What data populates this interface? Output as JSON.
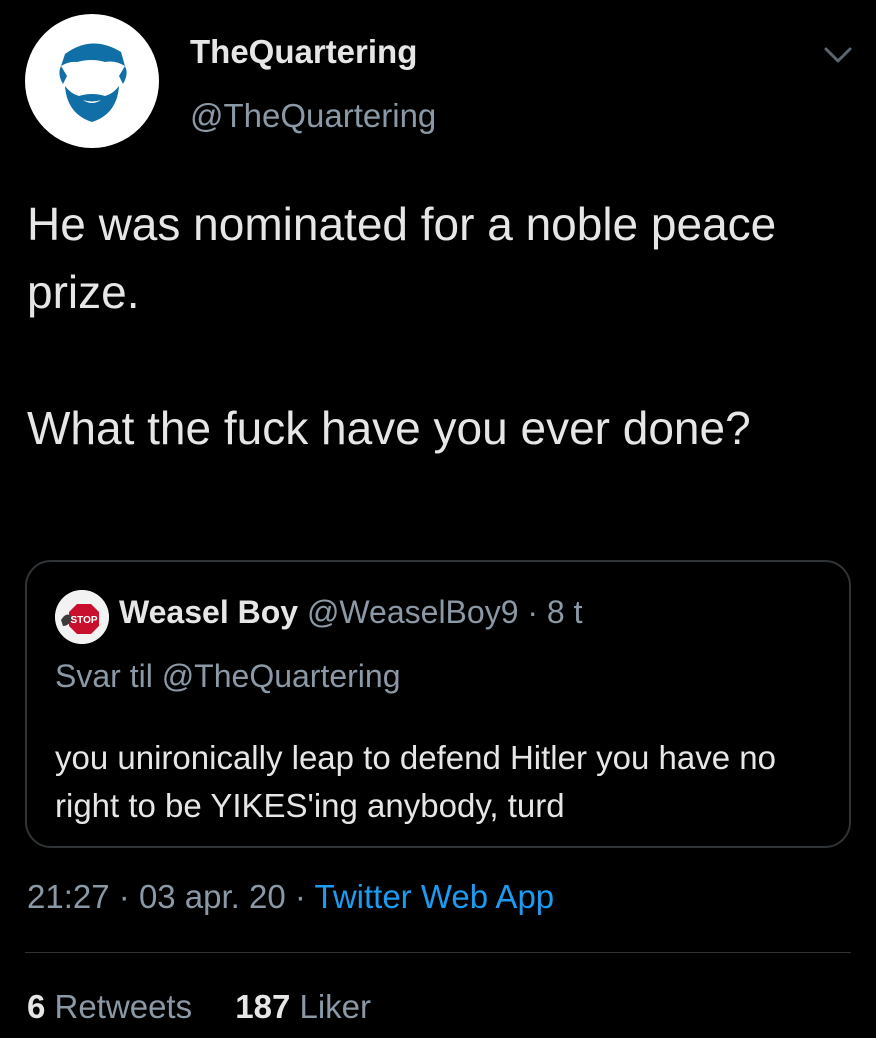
{
  "author": {
    "name": "TheQuartering",
    "handle": "@TheQuartering",
    "avatar_icon": "bearded-man-icon",
    "avatar_color": "#0f6fa6"
  },
  "tweet": {
    "paragraphs": [
      "He was nominated for a noble peace prize.",
      "What the fuck have you ever done?"
    ]
  },
  "quoted_tweet": {
    "name": "Weasel Boy",
    "handle": "@WeaselBoy9",
    "separator": "·",
    "time": "8 t",
    "replying_to": "Svar til @TheQuartering",
    "text": "you unironically leap to defend Hitler you have no right to be YIKES'ing anybody, turd",
    "avatar_text": "STOP"
  },
  "meta": {
    "time": "21:27",
    "sep1": "·",
    "date": "03 apr. 20",
    "sep2": "·",
    "source": "Twitter Web App"
  },
  "stats": {
    "retweets_count": "6",
    "retweets_label": "Retweets",
    "likes_count": "187",
    "likes_label": "Liker"
  },
  "colors": {
    "background": "#000000",
    "text": "#e6e6e6",
    "muted": "#8b98a5",
    "link": "#1d9bf0",
    "border": "#2f3336"
  }
}
